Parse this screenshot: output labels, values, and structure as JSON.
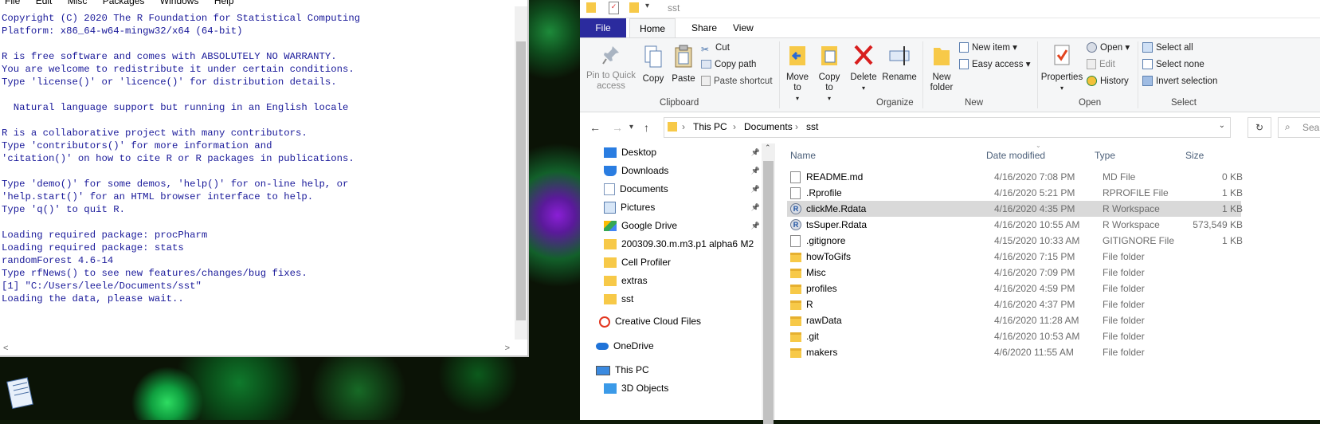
{
  "r_console": {
    "menu": [
      "File",
      "Edit",
      "Misc",
      "Packages",
      "Windows",
      "Help"
    ],
    "lines": [
      "Copyright (C) 2020 The R Foundation for Statistical Computing",
      "Platform: x86_64-w64-mingw32/x64 (64-bit)",
      "",
      "R is free software and comes with ABSOLUTELY NO WARRANTY.",
      "You are welcome to redistribute it under certain conditions.",
      "Type 'license()' or 'licence()' for distribution details.",
      "",
      "  Natural language support but running in an English locale",
      "",
      "R is a collaborative project with many contributors.",
      "Type 'contributors()' for more information and",
      "'citation()' on how to cite R or R packages in publications.",
      "",
      "Type 'demo()' for some demos, 'help()' for on-line help, or",
      "'help.start()' for an HTML browser interface to help.",
      "Type 'q()' to quit R.",
      "",
      "Loading required package: procPharm",
      "Loading required package: stats",
      "randomForest 4.6-14",
      "Type rfNews() to see new features/changes/bug fixes.",
      "[1] \"C:/Users/leele/Documents/sst\"",
      "Loading the data, please wait.."
    ],
    "scroll_left": "<",
    "scroll_right": ">"
  },
  "explorer": {
    "title": "sst",
    "tabs": {
      "file": "File",
      "home": "Home",
      "share": "Share",
      "view": "View"
    },
    "ribbon": {
      "pin": "Pin to Quick access",
      "copy": "Copy",
      "paste": "Paste",
      "cut": "Cut",
      "copy_path": "Copy path",
      "paste_shortcut": "Paste shortcut",
      "clipboard": "Clipboard",
      "move_to": "Move to",
      "copy_to": "Copy to",
      "delete": "Delete",
      "rename": "Rename",
      "organize": "Organize",
      "new_folder": "New folder",
      "new_item": "New item",
      "easy_access": "Easy access",
      "new_group": "New",
      "properties": "Properties",
      "open": "Open",
      "edit": "Edit",
      "history": "History",
      "open_group": "Open",
      "select_all": "Select all",
      "select_none": "Select none",
      "invert_selection": "Invert selection",
      "select_group": "Select"
    },
    "address": {
      "crumbs": [
        "This PC",
        "Documents",
        "sst"
      ],
      "search_placeholder": "Sear"
    },
    "nav": [
      {
        "label": "Desktop",
        "icon": "desktop-icon",
        "pinned": true
      },
      {
        "label": "Downloads",
        "icon": "download-icon",
        "pinned": true
      },
      {
        "label": "Documents",
        "icon": "documents-icon",
        "pinned": true
      },
      {
        "label": "Pictures",
        "icon": "pictures-icon",
        "pinned": true
      },
      {
        "label": "Google Drive",
        "icon": "google-drive-icon",
        "pinned": true
      },
      {
        "label": "200309.30.m.m3.p1 alpha6 M2",
        "icon": "folder-icon",
        "pinned": false
      },
      {
        "label": "Cell Profiler",
        "icon": "folder-icon",
        "pinned": false
      },
      {
        "label": "extras",
        "icon": "folder-icon",
        "pinned": false
      },
      {
        "label": "sst",
        "icon": "folder-icon",
        "pinned": false
      },
      {
        "label": "Creative Cloud Files",
        "icon": "creative-cloud-icon",
        "pinned": false
      },
      {
        "label": "OneDrive",
        "icon": "onedrive-icon",
        "pinned": false
      },
      {
        "label": "This PC",
        "icon": "this-pc-icon",
        "pinned": false
      },
      {
        "label": "3D Objects",
        "icon": "3d-objects-icon",
        "pinned": false
      }
    ],
    "columns": {
      "name": "Name",
      "date": "Date modified",
      "type": "Type",
      "size": "Size"
    },
    "files": [
      {
        "name": "README.md",
        "date": "4/16/2020 7:08 PM",
        "type": "MD File",
        "size": "0 KB",
        "icon": "doc"
      },
      {
        "name": ".Rprofile",
        "date": "4/16/2020 5:21 PM",
        "type": "RPROFILE File",
        "size": "1 KB",
        "icon": "doc"
      },
      {
        "name": "clickMe.Rdata",
        "date": "4/16/2020 4:35 PM",
        "type": "R Workspace",
        "size": "1 KB",
        "icon": "r"
      },
      {
        "name": "tsSuper.Rdata",
        "date": "4/16/2020 10:55 AM",
        "type": "R Workspace",
        "size": "573,549 KB",
        "icon": "r"
      },
      {
        "name": ".gitignore",
        "date": "4/15/2020 10:33 AM",
        "type": "GITIGNORE File",
        "size": "1 KB",
        "icon": "doc"
      },
      {
        "name": "howToGifs",
        "date": "4/16/2020 7:15 PM",
        "type": "File folder",
        "size": "",
        "icon": "folder"
      },
      {
        "name": "Misc",
        "date": "4/16/2020 7:09 PM",
        "type": "File folder",
        "size": "",
        "icon": "folder"
      },
      {
        "name": "profiles",
        "date": "4/16/2020 4:59 PM",
        "type": "File folder",
        "size": "",
        "icon": "folder"
      },
      {
        "name": "R",
        "date": "4/16/2020 4:37 PM",
        "type": "File folder",
        "size": "",
        "icon": "folder"
      },
      {
        "name": "rawData",
        "date": "4/16/2020 11:28 AM",
        "type": "File folder",
        "size": "",
        "icon": "folder"
      },
      {
        "name": ".git",
        "date": "4/16/2020 10:53 AM",
        "type": "File folder",
        "size": "",
        "icon": "folder"
      },
      {
        "name": "makers",
        "date": "4/6/2020 11:55 AM",
        "type": "File folder",
        "size": "",
        "icon": "folder"
      }
    ],
    "selected_file": "clickMe.Rdata"
  }
}
